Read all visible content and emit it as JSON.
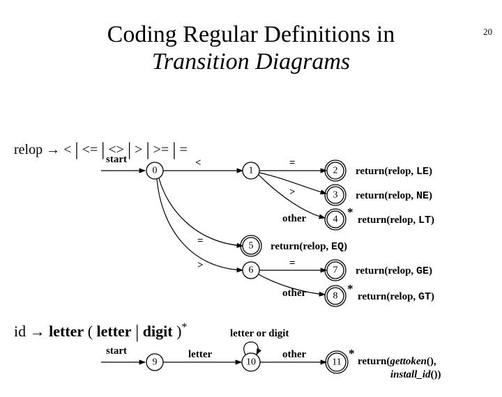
{
  "page_number": "20",
  "title_line1": "Coding Regular Definitions in",
  "title_line2": "Transition Diagrams",
  "relop_production": "relop → < | <= | <> | > | >= | =",
  "id_production_lhs": "id → letter",
  "id_production_rhs": "( letter | digit )",
  "id_production_star": "*",
  "start_label": "start",
  "states": {
    "s0": "0",
    "s1": "1",
    "s2": "2",
    "s3": "3",
    "s4": "4",
    "s5": "5",
    "s6": "6",
    "s7": "7",
    "s8": "8",
    "s9": "9",
    "s10": "10",
    "s11": "11"
  },
  "edge_labels": {
    "lt": "<",
    "eq": "=",
    "gt": ">",
    "other": "other",
    "letter": "letter",
    "letter_or_digit": "letter or digit"
  },
  "actions": {
    "a2_pre": "return(relop, ",
    "a2_tok": "LE",
    "a3_pre": "return(relop, ",
    "a3_tok": "NE",
    "a4_pre": "return(relop, ",
    "a4_tok": "LT",
    "a5_pre": "return(relop, ",
    "a5_tok": "EQ",
    "a7_pre": "return(relop, ",
    "a7_tok": "GE",
    "a8_pre": "return(relop, ",
    "a8_tok": "GT",
    "a11_l1_pre": "return(",
    "a11_l1_it": "gettoken",
    "a11_l1_post": "(),",
    "a11_l2_it": "install_id",
    "a11_l2_post": "())",
    "close_paren": ")"
  },
  "star": "*"
}
